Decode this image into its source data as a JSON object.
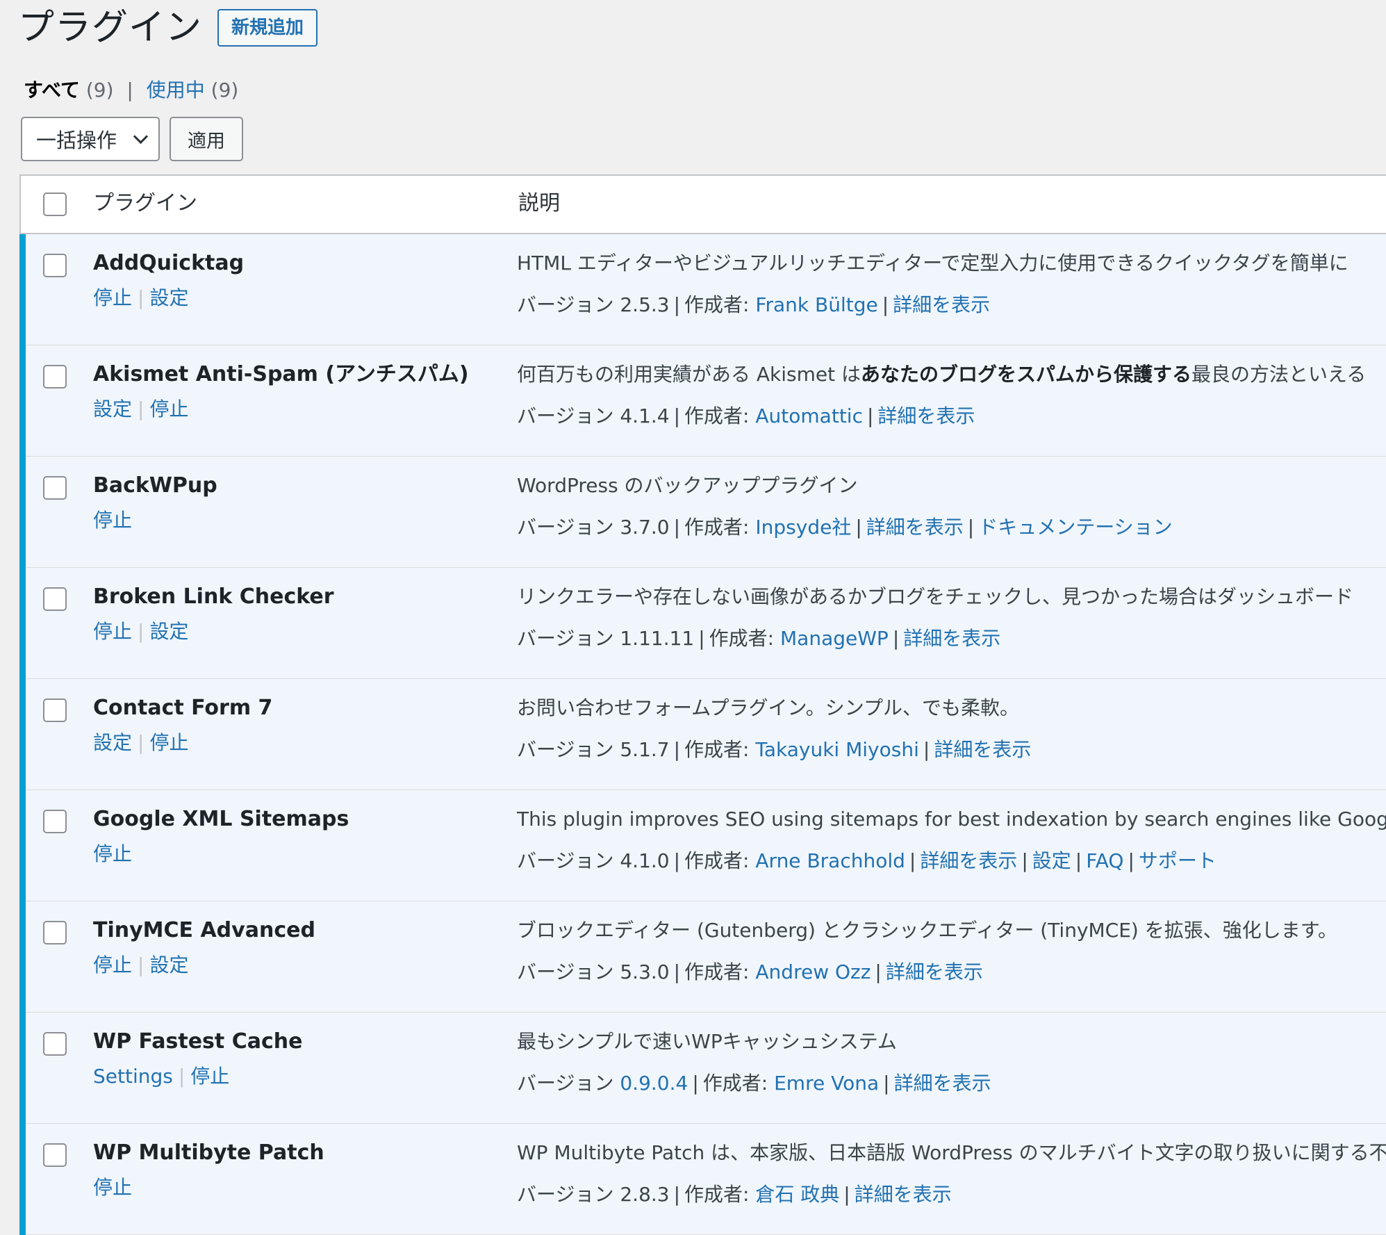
{
  "header": {
    "title": "プラグイン",
    "add_new": "新規追加"
  },
  "filters": {
    "all_label": "すべて",
    "all_count": "(9)",
    "active_label": "使用中",
    "active_count": "(9)",
    "separator": "|"
  },
  "bulk": {
    "select_label": "一括操作",
    "apply_label": "適用"
  },
  "table": {
    "col_plugin": "プラグイン",
    "col_description": "説明",
    "version_prefix": "バージョン",
    "author_prefix": "作成者:",
    "rows": [
      {
        "name": "AddQuicktag",
        "actions": [
          "停止",
          "設定"
        ],
        "desc_parts": [
          "HTML エディターやビジュアルリッチエディターで定型入力に使用できるクイックタグを簡単に"
        ],
        "version": "2.5.3",
        "author": "Frank Bültge",
        "links": [
          "詳細を表示"
        ]
      },
      {
        "name": "Akismet Anti-Spam (アンチスパム)",
        "actions": [
          "設定",
          "停止"
        ],
        "desc_parts": [
          "何百万もの利用実績がある Akismet は",
          "あなたのブログをスパムから保護する",
          "最良の方法といえる"
        ],
        "version": "4.1.4",
        "author": "Automattic",
        "links": [
          "詳細を表示"
        ]
      },
      {
        "name": "BackWPup",
        "actions": [
          "停止"
        ],
        "desc_parts": [
          "WordPress のバックアッププラグイン"
        ],
        "version": "3.7.0",
        "author": "Inpsyde社",
        "links": [
          "詳細を表示",
          "ドキュメンテーション"
        ]
      },
      {
        "name": "Broken Link Checker",
        "actions": [
          "停止",
          "設定"
        ],
        "desc_parts": [
          "リンクエラーや存在しない画像があるかブログをチェックし、見つかった場合はダッシュボード"
        ],
        "version": "1.11.11",
        "author": "ManageWP",
        "links": [
          "詳細を表示"
        ]
      },
      {
        "name": "Contact Form 7",
        "actions": [
          "設定",
          "停止"
        ],
        "desc_parts": [
          "お問い合わせフォームプラグイン。シンプル、でも柔軟。"
        ],
        "version": "5.1.7",
        "author": "Takayuki Miyoshi",
        "links": [
          "詳細を表示"
        ]
      },
      {
        "name": "Google XML Sitemaps",
        "actions": [
          "停止"
        ],
        "desc_parts": [
          "This plugin improves SEO using sitemaps for best indexation by search engines like Google, Bing,"
        ],
        "version": "4.1.0",
        "author": "Arne Brachhold",
        "links": [
          "詳細を表示",
          "設定",
          "FAQ",
          "サポート"
        ]
      },
      {
        "name": "TinyMCE Advanced",
        "actions": [
          "停止",
          "設定"
        ],
        "desc_parts": [
          "ブロックエディター (Gutenberg) とクラシックエディター (TinyMCE) を拡張、強化します。"
        ],
        "version": "5.3.0",
        "author": "Andrew Ozz",
        "links": [
          "詳細を表示"
        ]
      },
      {
        "name": "WP Fastest Cache",
        "actions": [
          "Settings",
          "停止"
        ],
        "desc_parts": [
          "最もシンプルで速いWPキャッシュシステム"
        ],
        "version": "0.9.0.4",
        "version_is_link": true,
        "author": "Emre Vona",
        "links": [
          "詳細を表示"
        ]
      },
      {
        "name": "WP Multibyte Patch",
        "actions": [
          "停止"
        ],
        "desc_parts": [
          "WP Multibyte Patch は、本家版、日本語版 WordPress のマルチバイト文字の取り扱いに関する不"
        ],
        "version": "2.8.3",
        "author": "倉石 政典",
        "links": [
          "詳細を表示"
        ]
      }
    ]
  },
  "colors": {
    "accent": "#2271b1",
    "active_bar": "#00a0d2",
    "active_row_bg": "#f0f6fc"
  }
}
